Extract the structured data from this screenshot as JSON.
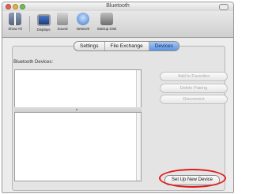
{
  "window": {
    "title": "Bluetooth"
  },
  "toolbar": {
    "items": [
      {
        "label": "Show All",
        "icon": "show-all-icon"
      },
      {
        "label": "Displays",
        "icon": "displays-icon"
      },
      {
        "label": "Sound",
        "icon": "sound-icon"
      },
      {
        "label": "Network",
        "icon": "network-icon"
      },
      {
        "label": "Startup Disk",
        "icon": "startup-disk-icon"
      }
    ]
  },
  "tabs": [
    {
      "label": "Settings",
      "active": false
    },
    {
      "label": "File Exchange",
      "active": false
    },
    {
      "label": "Devices",
      "active": true
    }
  ],
  "devices": {
    "list_label": "Bluetooth Devices:",
    "buttons": {
      "add_favorites": "Add to Favorites",
      "delete_pairing": "Delete Pairing",
      "disconnect": "Disconnect",
      "setup_new_device": "Set Up New Device"
    }
  },
  "colors": {
    "highlight_ring": "#e21b1b",
    "active_tab": "#5e94e2"
  }
}
